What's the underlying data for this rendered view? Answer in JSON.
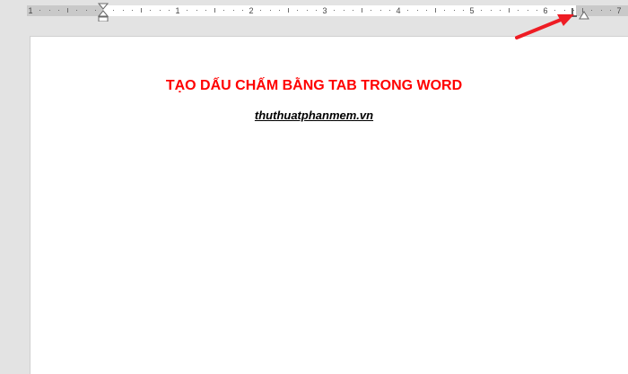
{
  "ruler": {
    "numbers": [
      "1",
      "1",
      "2",
      "3",
      "4",
      "5",
      "6",
      "7"
    ]
  },
  "document": {
    "title": "TẠO DẤU CHẤM BẰNG TAB TRONG WORD",
    "subtitle": "thuthuatphanmem.vn"
  },
  "colors": {
    "title": "#ff0000",
    "annotation_arrow": "#ee1c24",
    "ruler_margin": "#c9c9c9",
    "ruler_body": "#ffffff",
    "workspace": "#e3e3e3"
  },
  "icons": {
    "indent_markers": "hourglass-indent-icon",
    "right_indent": "right-indent-triangle-icon",
    "tab_stop": "tab-stop-icon",
    "annotation": "red-arrow-icon"
  }
}
